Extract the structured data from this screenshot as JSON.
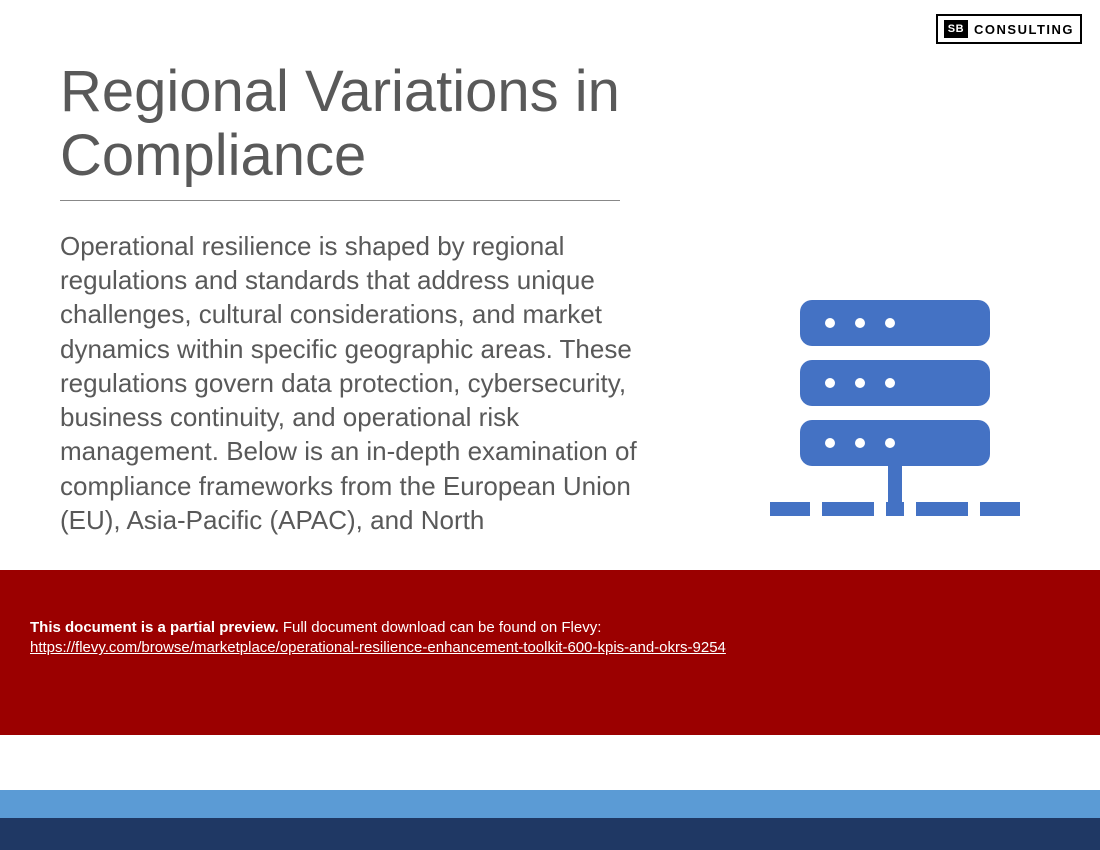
{
  "logo": {
    "mark": "SB",
    "text": "CONSULTING"
  },
  "slide": {
    "title": "Regional Variations in Compliance",
    "body": "Operational resilience is shaped by regional regulations and standards that address unique challenges, cultural considerations, and market dynamics within specific geographic areas. These regulations govern data protection, cybersecurity, business continuity, and operational risk management. Below is an in-depth examination of compliance frameworks from the European Union (EU), Asia-Pacific (APAC), and North"
  },
  "overlay": {
    "lead_bold": "This document is a partial preview.",
    "lead_rest": " Full document download can be found on Flevy:",
    "link_text": "https://flevy.com/browse/marketplace/operational-resilience-enhancement-toolkit-600-kpis-and-okrs-9254",
    "link_href": "https://flevy.com/browse/marketplace/operational-resilience-enhancement-toolkit-600-kpis-and-okrs-9254"
  },
  "icon": {
    "name": "server-stack-icon",
    "color": "#4472c4"
  },
  "theme": {
    "overlay_bg": "#9b0000",
    "accent_skyblue": "#5b9bd5",
    "accent_navy": "#1f3864"
  }
}
